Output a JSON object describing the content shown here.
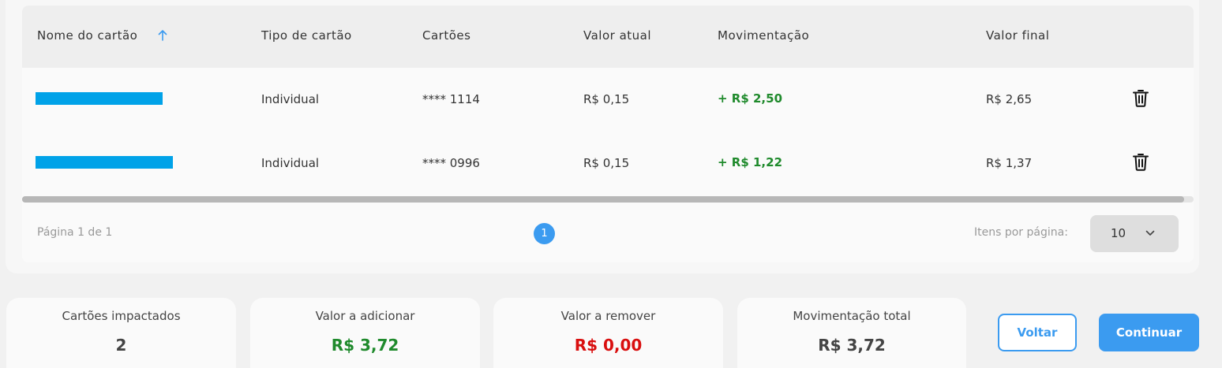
{
  "table": {
    "headers": {
      "name": "Nome do cartão",
      "type": "Tipo de cartão",
      "cards": "Cartões",
      "current": "Valor atual",
      "movement": "Movimentação",
      "final": "Valor final"
    },
    "sort_icon": "arrow-up-icon",
    "rows": [
      {
        "name": "",
        "type": "Individual",
        "card": "**** 1114",
        "current": "R$ 0,15",
        "movement": "+ R$ 2,50",
        "final": "R$ 2,65"
      },
      {
        "name": "",
        "type": "Individual",
        "card": "**** 0996",
        "current": "R$ 0,15",
        "movement": "+ R$ 1,22",
        "final": "R$ 1,37"
      }
    ],
    "row_action_icon": "trash-icon"
  },
  "pagination": {
    "summary": "Página 1 de 1",
    "current_page": "1",
    "items_per_page_label": "Itens por página:",
    "items_per_page_value": "10"
  },
  "summary": {
    "cards_impacted_label": "Cartões impactados",
    "cards_impacted_value": "2",
    "add_label": "Valor a adicionar",
    "add_value": "R$ 3,72",
    "remove_label": "Valor a remover",
    "remove_value": "R$ 0,00",
    "total_label": "Movimentação total",
    "total_value": "R$ 3,72"
  },
  "actions": {
    "back_label": "Voltar",
    "continue_label": "Continuar"
  },
  "colors": {
    "accent": "#3b9bf0",
    "positive": "#1f8a2c",
    "negative": "#d90f0f",
    "redaction": "#00a2e8"
  }
}
